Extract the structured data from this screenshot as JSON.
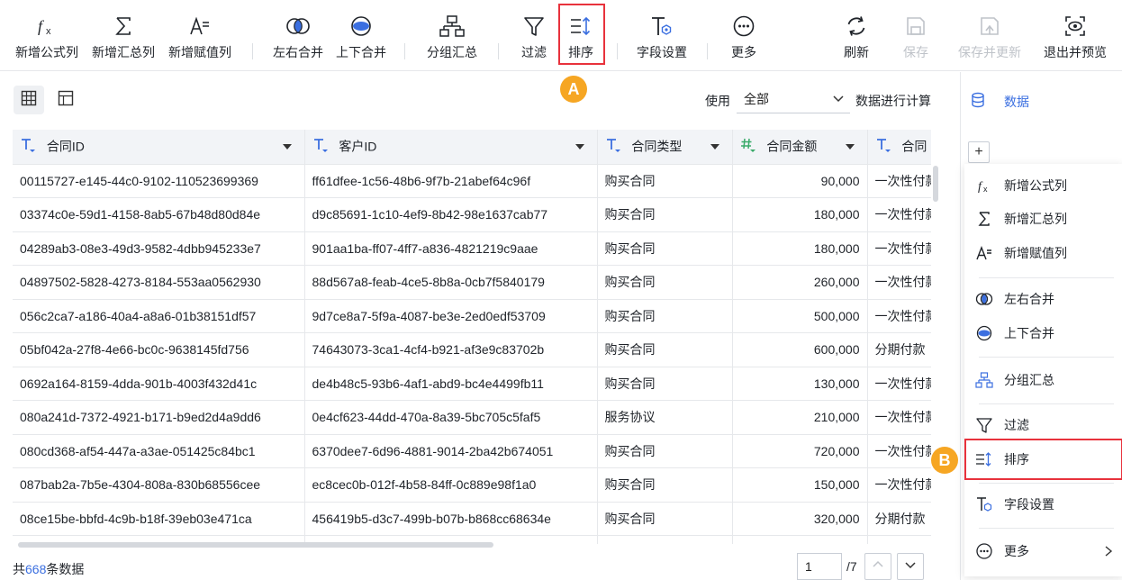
{
  "toolbar": {
    "items": [
      {
        "label": "新增公式列",
        "icon": "formula-icon"
      },
      {
        "label": "新增汇总列",
        "icon": "sigma-icon"
      },
      {
        "label": "新增赋值列",
        "icon": "assign-icon"
      },
      {
        "label": "左右合并",
        "icon": "merge-lr-icon"
      },
      {
        "label": "上下合并",
        "icon": "merge-tb-icon"
      },
      {
        "label": "分组汇总",
        "icon": "group-icon"
      },
      {
        "label": "过滤",
        "icon": "filter-icon"
      },
      {
        "label": "排序",
        "icon": "sort-icon"
      },
      {
        "label": "字段设置",
        "icon": "field-settings-icon"
      },
      {
        "label": "更多",
        "icon": "more-icon"
      },
      {
        "label": "刷新",
        "icon": "refresh-icon"
      },
      {
        "label": "保存",
        "icon": "save-icon",
        "disabled": true
      },
      {
        "label": "保存并更新",
        "icon": "save-update-icon",
        "disabled": true
      },
      {
        "label": "退出并预览",
        "icon": "exit-preview-icon"
      }
    ]
  },
  "markers": {
    "a": "A",
    "b": "B"
  },
  "filter_bar": {
    "use_label": "使用",
    "select_value": "全部",
    "suffix_label": "数据进行计算"
  },
  "table": {
    "columns": [
      {
        "name": "合同ID",
        "type": "text"
      },
      {
        "name": "客户ID",
        "type": "text"
      },
      {
        "name": "合同类型",
        "type": "text"
      },
      {
        "name": "合同金额",
        "type": "number"
      },
      {
        "name": "合同",
        "type": "text"
      }
    ],
    "rows": [
      [
        "00115727-e145-44c0-9102-110523699369",
        "ff61dfee-1c56-48b6-9f7b-21abef64c96f",
        "购买合同",
        "90,000",
        "一次性付款"
      ],
      [
        "03374c0e-59d1-4158-8ab5-67b48d80d84e",
        "d9c85691-1c10-4ef9-8b42-98e1637cab77",
        "购买合同",
        "180,000",
        "一次性付款"
      ],
      [
        "04289ab3-08e3-49d3-9582-4dbb945233e7",
        "901aa1ba-ff07-4ff7-a836-4821219c9aae",
        "购买合同",
        "180,000",
        "一次性付款"
      ],
      [
        "04897502-5828-4273-8184-553aa0562930",
        "88d567a8-feab-4ce5-8b8a-0cb7f5840179",
        "购买合同",
        "260,000",
        "一次性付款"
      ],
      [
        "056c2ca7-a186-40a4-a8a6-01b38151df57",
        "9d7ce8a7-5f9a-4087-be3e-2ed0edf53709",
        "购买合同",
        "500,000",
        "一次性付款"
      ],
      [
        "05bf042a-27f8-4e66-bc0c-9638145fd756",
        "74643073-3ca1-4cf4-b921-af3e9c83702b",
        "购买合同",
        "600,000",
        "分期付款"
      ],
      [
        "0692a164-8159-4dda-901b-4003f432d41c",
        "de4b48c5-93b6-4af1-abd9-bc4e4499fb11",
        "购买合同",
        "130,000",
        "一次性付款"
      ],
      [
        "080a241d-7372-4921-b171-b9ed2d4a9dd6",
        "0e4cf623-44dd-470a-8a39-5bc705c5faf5",
        "服务协议",
        "210,000",
        "一次性付款"
      ],
      [
        "080cd368-af54-447a-a3ae-051425c84bc1",
        "6370dee7-6d96-4881-9014-2ba42b674051",
        "购买合同",
        "720,000",
        "一次性付款"
      ],
      [
        "087bab2a-7b5e-4304-808a-830b68556cee",
        "ec8cec0b-012f-4b58-84ff-0c889e98f1a0",
        "购买合同",
        "150,000",
        "一次性付款"
      ],
      [
        "08ce15be-bbfd-4c9b-b18f-39eb03e471ca",
        "456419b5-d3c7-499b-b07b-b868cc68634e",
        "购买合同",
        "320,000",
        "分期付款"
      ],
      [
        "",
        "",
        "",
        "",
        ""
      ]
    ]
  },
  "footer": {
    "prefix": "共",
    "count": "668",
    "suffix": "条数据",
    "page": "1",
    "total_pages": "/7"
  },
  "side": {
    "title": "数据",
    "add_label": "+",
    "menu": [
      {
        "label": "新增公式列",
        "icon": "formula-icon"
      },
      {
        "label": "新增汇总列",
        "icon": "sigma-icon"
      },
      {
        "label": "新增赋值列",
        "icon": "assign-icon"
      },
      {
        "label": "左右合并",
        "icon": "merge-lr-icon"
      },
      {
        "label": "上下合并",
        "icon": "merge-tb-icon"
      },
      {
        "label": "分组汇总",
        "icon": "group-icon"
      },
      {
        "label": "过滤",
        "icon": "filter-icon"
      },
      {
        "label": "排序",
        "icon": "sort-icon"
      },
      {
        "label": "字段设置",
        "icon": "field-settings-icon"
      },
      {
        "label": "更多",
        "icon": "more-icon"
      }
    ]
  },
  "colors": {
    "accent": "#3b6fe0",
    "highlight": "#e8323c",
    "marker": "#f6a623"
  }
}
